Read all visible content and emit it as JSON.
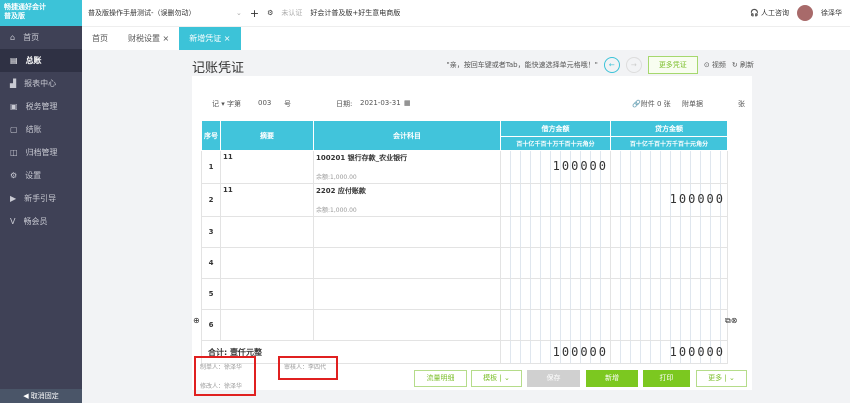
{
  "sidebar": {
    "logo": "畅捷通好会计",
    "edition": "普及版",
    "items": [
      {
        "label": "首页",
        "icon": "home-icon"
      },
      {
        "label": "总账",
        "icon": "ledger-icon"
      },
      {
        "label": "报表中心",
        "icon": "chart-icon"
      },
      {
        "label": "税务管理",
        "icon": "tax-icon"
      },
      {
        "label": "结账",
        "icon": "close-account-icon"
      },
      {
        "label": "归档管理",
        "icon": "archive-icon"
      },
      {
        "label": "设置",
        "icon": "gear-icon"
      },
      {
        "label": "新手引导",
        "icon": "guide-icon"
      },
      {
        "label": "畅会员",
        "icon": "vip-icon"
      }
    ],
    "footer": "取消固定"
  },
  "topbar": {
    "account": "普及版操作手册测试-（误删勿动）",
    "cert": "未认证",
    "product": "好会计普及版+好生意电商版",
    "support": "人工咨询",
    "user": "徐泽华"
  },
  "tabs": [
    {
      "label": "首页"
    },
    {
      "label": "财税设置 ×"
    },
    {
      "label": "新增凭证 ×"
    }
  ],
  "page": {
    "title": "记账凭证",
    "hint": "\"亲，按回车键或者Tab，能快速选择单元格哦！\"",
    "more_vouchers": "更多凭证",
    "video": "视频",
    "refresh": "刷新"
  },
  "voucher": {
    "word": "记",
    "word_label": "字第",
    "number": "003",
    "number_suffix": "号",
    "date_label": "日期:",
    "date": "2021-03-31",
    "attach": "附件 0 张",
    "attach_doc": "附单据",
    "attach_unit": "张"
  },
  "table": {
    "headers": {
      "seq": "序号",
      "summary": "摘要",
      "account": "会计科目",
      "debit": "借方金额",
      "credit": "贷方金额"
    },
    "units": [
      "百",
      "十",
      "亿",
      "千",
      "百",
      "十",
      "万",
      "千",
      "百",
      "十",
      "元",
      "角",
      "分"
    ],
    "rows": [
      {
        "seq": "1",
        "summary": "11",
        "account": "100201 银行存款_农业银行",
        "balance": "余额:1,000.00",
        "debit": "100000",
        "credit": ""
      },
      {
        "seq": "2",
        "summary": "11",
        "account": "2202 应付账款",
        "balance": "余额:1,000.00",
        "debit": "",
        "credit": "100000"
      },
      {
        "seq": "3"
      },
      {
        "seq": "4"
      },
      {
        "seq": "5"
      },
      {
        "seq": "6"
      }
    ],
    "total_label": "合计:",
    "total_words": "壹仟元整",
    "total_debit": "100000",
    "total_credit": "100000"
  },
  "signatures": {
    "maker": "制单人：徐泽华",
    "modifier": "修改人：徐泽华",
    "auditor": "审核人：李四代"
  },
  "actions": {
    "cashflow": "流量明细",
    "template": "模板",
    "save": "保存",
    "new": "新增",
    "print": "打印",
    "more": "更多"
  }
}
